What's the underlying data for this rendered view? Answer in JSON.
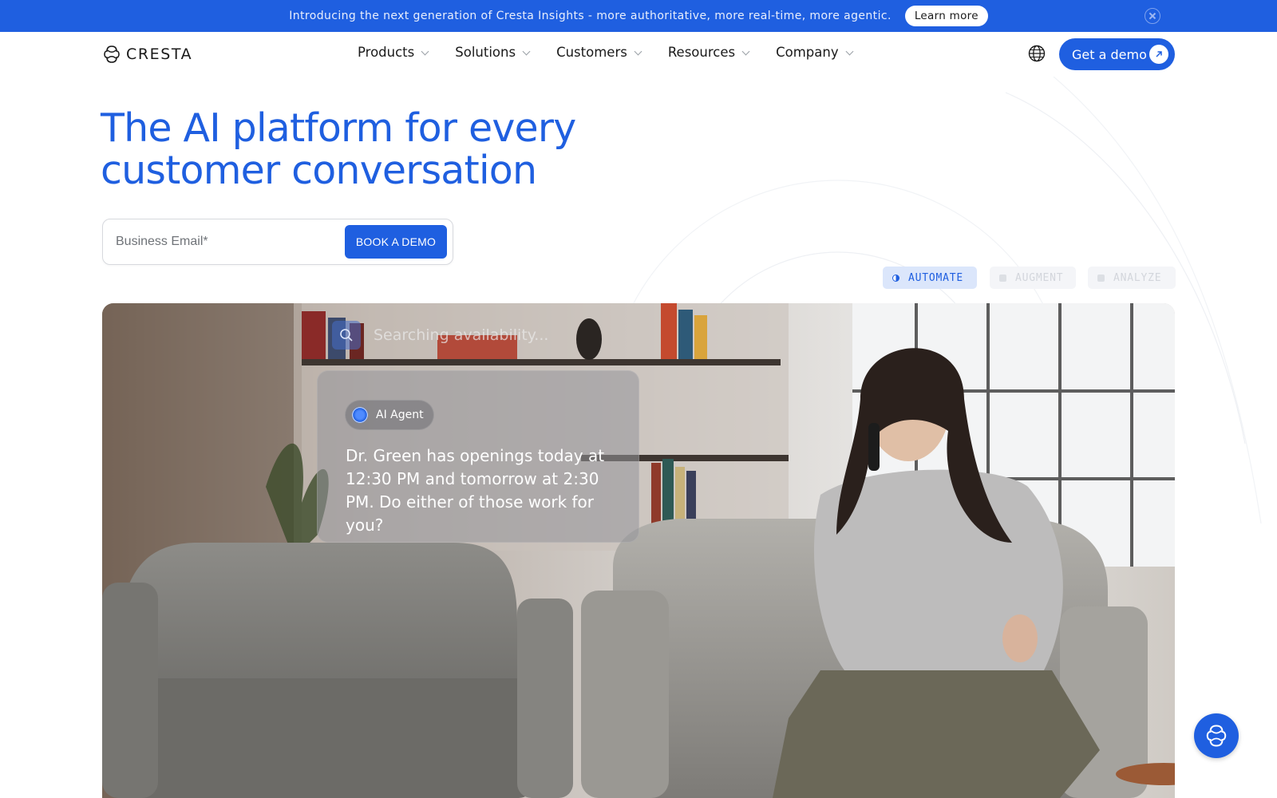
{
  "announcement": {
    "text": "Introducing the next generation of Cresta Insights - more authoritative, more real-time, more agentic.",
    "button_label": "Learn more"
  },
  "header": {
    "logo_text": "CRESTA",
    "nav": [
      "Products",
      "Solutions",
      "Customers",
      "Resources",
      "Company"
    ],
    "cta_label": "Get a demo"
  },
  "hero": {
    "title_line1": "The AI platform for every",
    "title_line2": "customer conversation",
    "email_placeholder": "Business Email*",
    "submit_label": "BOOK A DEMO"
  },
  "tabs": {
    "automate": "AUTOMATE",
    "augment": "AUGMENT",
    "analyze": "ANALYZE",
    "active": "AUTOMATE"
  },
  "video": {
    "search_status": "Searching availability...",
    "agent_label": "AI Agent",
    "agent_message": "Dr. Green has openings today at 12:30 PM and tomorrow at 2:30 PM. Do either of those work for you?"
  },
  "colors": {
    "brand_blue": "#1f5fe0",
    "tab_active_bg": "#dbe6fb"
  },
  "icons": [
    "cresta-logo-icon",
    "close-icon",
    "chevron-down-icon",
    "globe-icon",
    "arrow-up-right-icon",
    "search-icon",
    "chat-icon"
  ]
}
